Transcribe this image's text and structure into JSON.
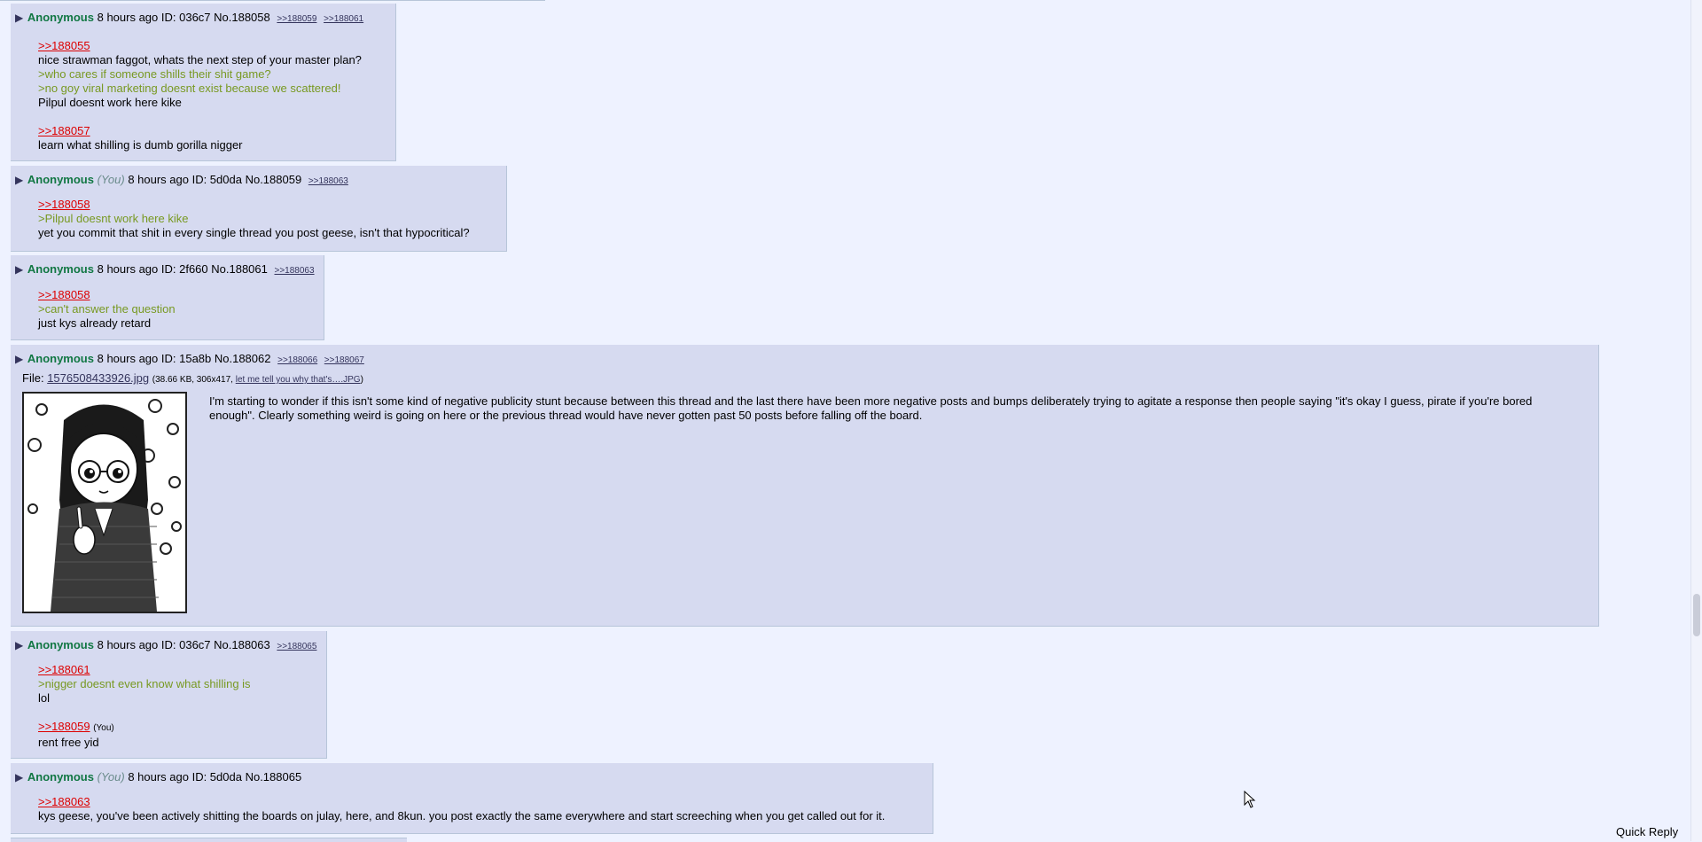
{
  "posts": [
    {
      "name": "Anonymous",
      "info": "8 hours ago ID: 036c7 No.188058",
      "backlinks": [
        ">>188059",
        ">>188061"
      ],
      "quote1": ">>188055",
      "line1": "nice strawman faggot, whats the next step of your master plan?",
      "gt1": ">who cares if someone shills their shit game?",
      "gt2": ">no goy viral marketing doesnt exist because we scattered!",
      "line2": "Pilpul doesnt work here kike",
      "quote2": ">>188057",
      "line3": "learn what shilling is dumb gorilla nigger"
    },
    {
      "name": "Anonymous",
      "you": "(You)",
      "info": "8 hours ago ID: 5d0da No.188059",
      "backlinks": [
        ">>188063"
      ],
      "quote1": ">>188058",
      "gt1": ">Pilpul doesnt work here kike",
      "line1": "yet you commit that shit in every single thread you post geese, isn't that hypocritical?"
    },
    {
      "name": "Anonymous",
      "info": "8 hours ago ID: 2f660 No.188061",
      "backlinks": [
        ">>188063"
      ],
      "quote1": ">>188058",
      "gt1": ">can't answer the question",
      "line1": "just kys already retard"
    },
    {
      "name": "Anonymous",
      "info": "8 hours ago ID: 15a8b No.188062",
      "backlinks": [
        ">>188066",
        ">>188067"
      ],
      "file_label": "File:",
      "file_name": "1576508433926.jpg",
      "file_meta_open": "(38.66 KB, 306x417,",
      "file_orig": "let me tell you why that's….JPG",
      "file_meta_close": ")",
      "line1": "I'm starting to wonder if this isn't some kind of negative publicity stunt because between this thread and the last there have been more negative posts and bumps deliberately trying to agitate a response then people saying \"it's okay I guess, pirate if you're bored enough\". Clearly something weird is going on here or the previous thread would have never gotten past 50 posts before falling off the board."
    },
    {
      "name": "Anonymous",
      "info": "8 hours ago ID: 036c7 No.188063",
      "backlinks": [
        ">>188065"
      ],
      "quote1": ">>188061",
      "gt1": ">nigger doesnt even know what shilling is",
      "line1": "lol",
      "quote2": ">>188059",
      "you2": "(You)",
      "line2": "rent free yid"
    },
    {
      "name": "Anonymous",
      "you": "(You)",
      "info": "8 hours ago ID: 5d0da No.188065",
      "quote1": ">>188063",
      "line1": "kys geese, you've been actively shitting the boards on julay, here, and 8kun. you post exactly the same everywhere and start screeching when you get called out for it."
    }
  ],
  "arrow_glyph": "▶",
  "quick_reply": "Quick Reply",
  "colors": {
    "page_bg": "#eef2ff",
    "post_bg": "#d6daf0",
    "name": "#117743",
    "quotelink": "#dd0000",
    "greentext": "#789922"
  }
}
